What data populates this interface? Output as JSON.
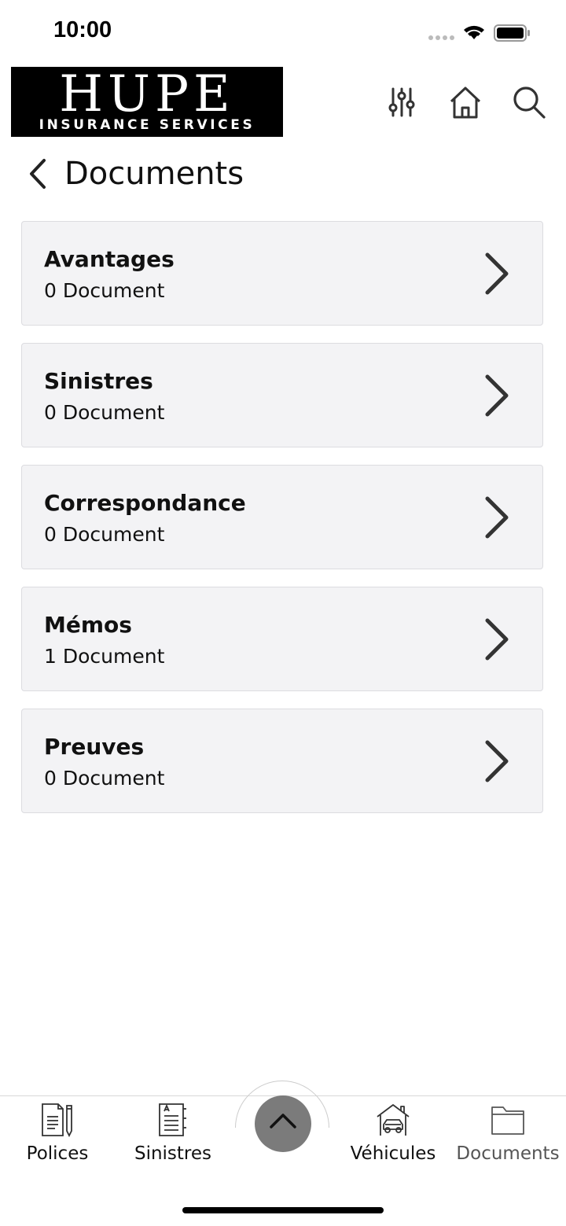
{
  "status_bar": {
    "time": "10:00"
  },
  "header": {
    "logo_main": "HUPE",
    "logo_sub": "INSURANCE SERVICES",
    "icons": [
      "filter-sliders-icon",
      "home-icon",
      "search-icon"
    ]
  },
  "page": {
    "title": "Documents"
  },
  "categories": [
    {
      "name": "Avantages",
      "count": "0 Document"
    },
    {
      "name": "Sinistres",
      "count": "0 Document"
    },
    {
      "name": "Correspondance",
      "count": "0 Document"
    },
    {
      "name": "Mémos",
      "count": "1 Document"
    },
    {
      "name": "Preuves",
      "count": "0 Document"
    }
  ],
  "tabbar": {
    "tabs": [
      {
        "label": "Polices",
        "icon": "policy-doc-icon"
      },
      {
        "label": "Sinistres",
        "icon": "claims-doc-icon"
      },
      {
        "label": "Véhicules",
        "icon": "car-house-icon"
      },
      {
        "label": "Documents",
        "icon": "folder-icon",
        "active": true
      }
    ],
    "center_icon": "chevron-up-icon"
  },
  "colors": {
    "card_bg": "#f3f3f5",
    "center_button": "#7b7b7b",
    "logo_bg": "#000000"
  }
}
